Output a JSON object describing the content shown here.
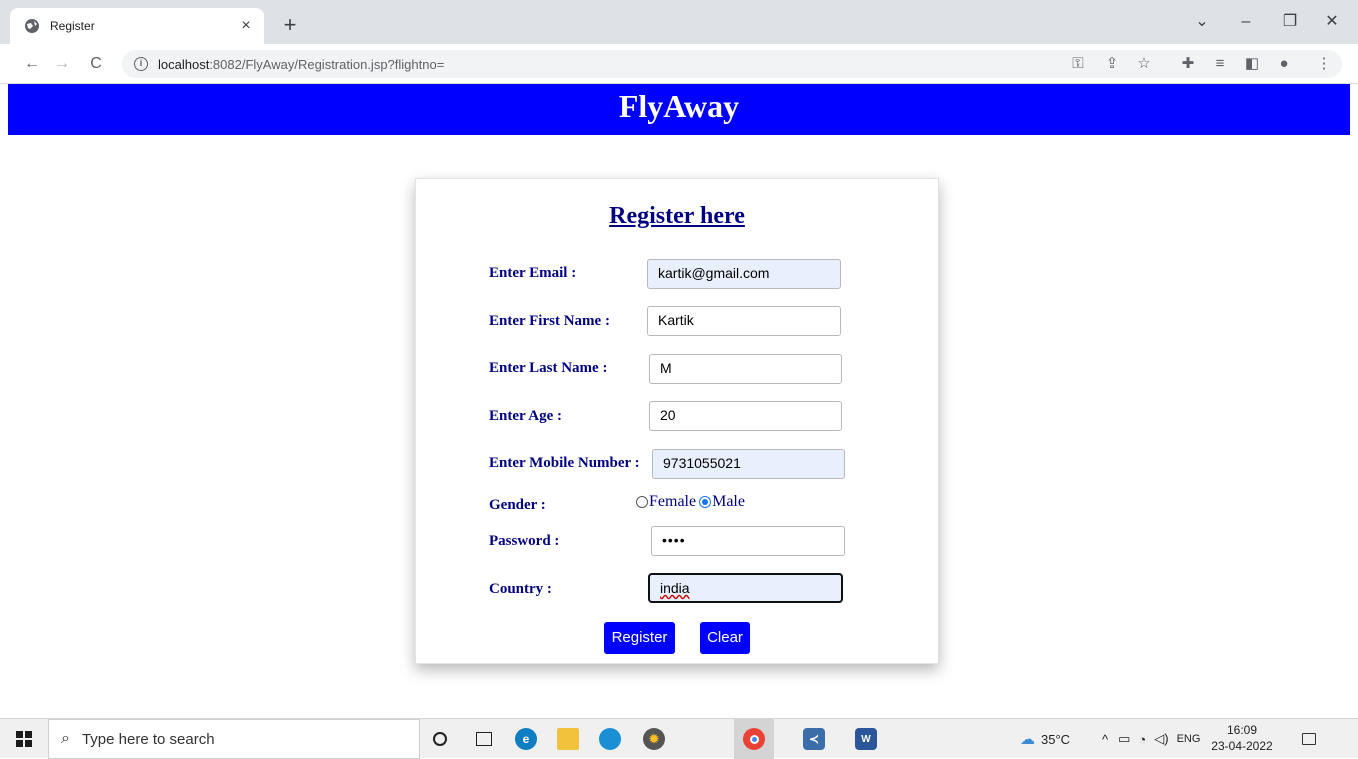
{
  "browser": {
    "tab_title": "Register",
    "tab_close": "×",
    "new_tab": "+",
    "url_host": "localhost",
    "url_path": ":8082/FlyAway/Registration.jsp?flightno=",
    "window_controls": {
      "tab_search": "⌄",
      "minimize": "–",
      "restore": "❐",
      "close": "✕"
    }
  },
  "page": {
    "banner_title": "FlyAway",
    "form_title": "Register here",
    "fields": {
      "email": {
        "label": "Enter Email :",
        "value": "kartik@gmail.com"
      },
      "first_name": {
        "label": "Enter First Name :",
        "value": "Kartik"
      },
      "last_name": {
        "label": "Enter Last Name :",
        "value": "M"
      },
      "age": {
        "label": "Enter Age :",
        "value": "20"
      },
      "mobile": {
        "label": "Enter Mobile Number :",
        "value": "9731055021"
      },
      "gender": {
        "label": "Gender :",
        "options": [
          "Female",
          "Male"
        ],
        "selected": "Male"
      },
      "password": {
        "label": "Password :",
        "value": "••••"
      },
      "country": {
        "label": "Country :",
        "value": "india"
      }
    },
    "buttons": {
      "register": "Register",
      "clear": "Clear"
    }
  },
  "taskbar": {
    "search_placeholder": "Type here to search",
    "weather": "35°C",
    "language": "ENG",
    "time": "16:09",
    "date": "23-04-2022"
  },
  "colors": {
    "banner": "#0000ff",
    "label": "#000080",
    "button": "#0000ff",
    "autofill": "#e8f0fe"
  }
}
